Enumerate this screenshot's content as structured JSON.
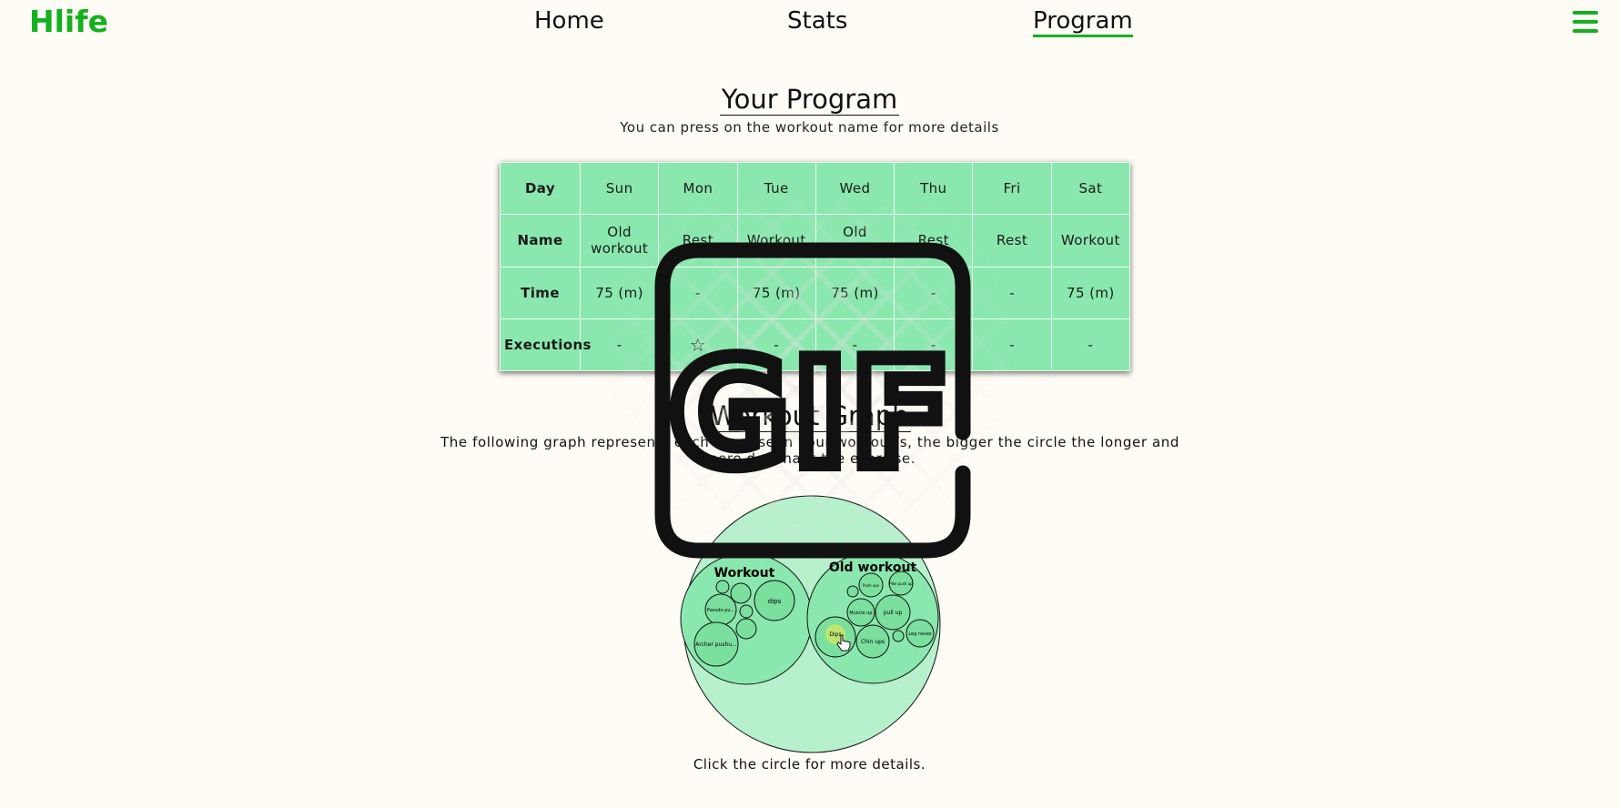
{
  "brand": "Hlife",
  "nav": {
    "home": "Home",
    "stats": "Stats",
    "program": "Program",
    "menu_icon": "hamburger-menu-icon"
  },
  "program": {
    "title": "Your Program",
    "subtitle": "You can press on the workout name for more details",
    "row_labels": [
      "Day",
      "Name",
      "Time",
      "Executions"
    ],
    "days": [
      "Sun",
      "Mon",
      "Tue",
      "Wed",
      "Thu",
      "Fri",
      "Sat"
    ],
    "names": [
      "Old workout",
      "Rest",
      "Workout",
      "Old workout",
      "Rest",
      "Rest",
      "Workout"
    ],
    "times": [
      "75 (m)",
      "-",
      "75 (m)",
      "75 (m)",
      "-",
      "-",
      "75 (m)"
    ],
    "executions": [
      "-",
      "☆",
      "-",
      "-",
      "-",
      "-",
      "-"
    ]
  },
  "graph": {
    "title": "Workout Graph",
    "description": "The following graph represents each exercise in your workout/s, the bigger the circle the longer and more dominant the exercise.",
    "hint": "Click the circle for more details.",
    "groups": [
      {
        "label": "Workout",
        "exercises": [
          "dips",
          "Pseudo pu...",
          "Archer pushu...",
          "",
          "",
          ""
        ]
      },
      {
        "label": "Old workout",
        "exercises": [
          "pull up",
          "Chin ups",
          "Dips",
          "Muscle up",
          "Leg raises",
          "Push ups",
          "Pike push up",
          ""
        ]
      }
    ],
    "colors": {
      "outer": "#b6f0cc",
      "inner": "#8ae8ae",
      "leaf": "#7bdf9d",
      "highlight": "#c8e66a"
    },
    "overlay_icon": "gif-icon",
    "cursor_icon": "hand-pointer-icon"
  }
}
